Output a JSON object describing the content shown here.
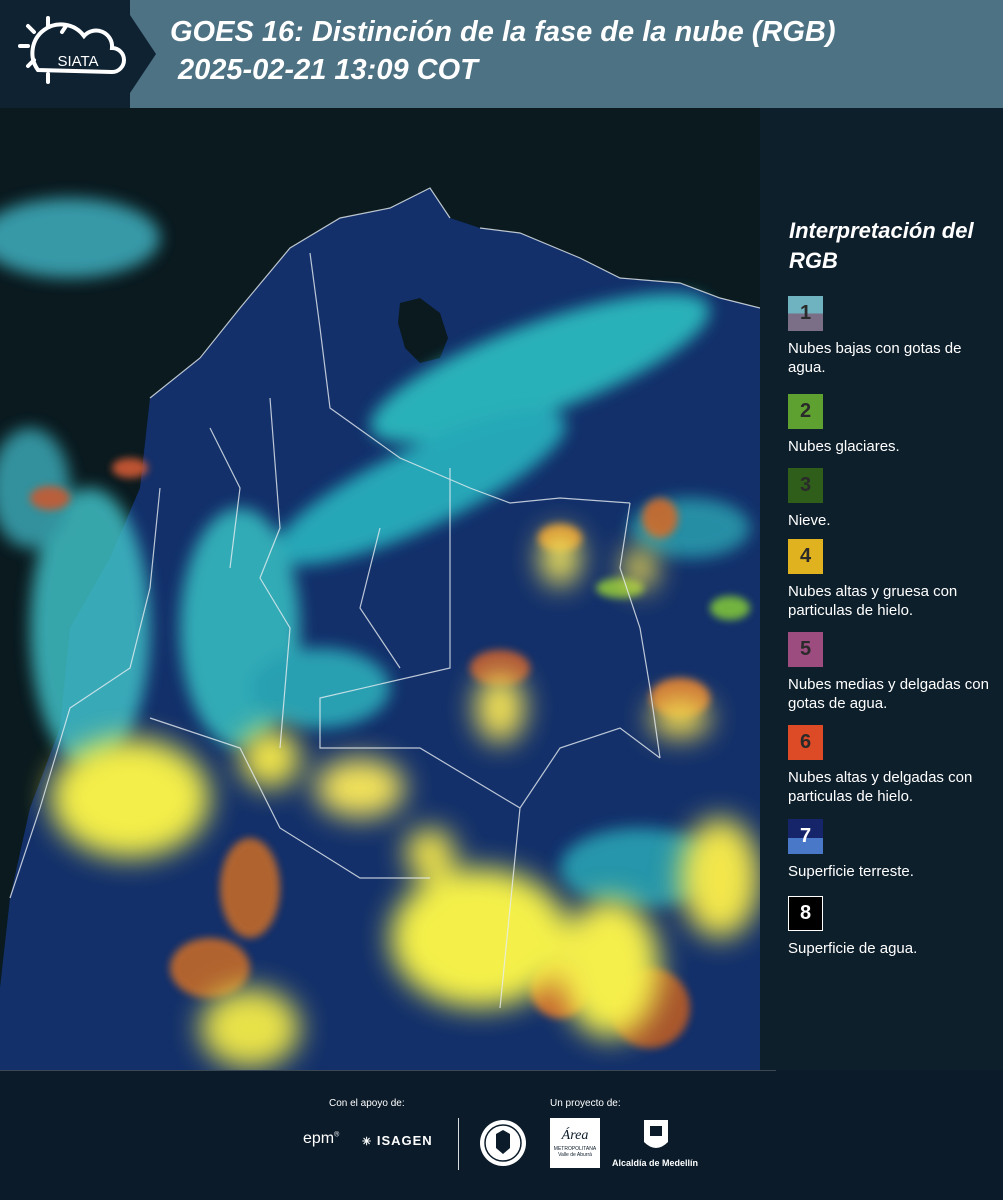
{
  "header": {
    "logo_text": "SIATA",
    "title": "GOES 16: Distinción de la fase de la nube (RGB)",
    "subtitle": "2025-02-21 13:09 COT"
  },
  "legend": {
    "title": "Interpretación del RGB",
    "items": [
      {
        "number": "1",
        "label": "Nubes bajas con gotas de agua.",
        "color_top": "#6fb3c0",
        "color_bottom": "#7a6f87"
      },
      {
        "number": "2",
        "label": "Nubes glaciares.",
        "color_top": "#5fa131",
        "color_bottom": "#5fa131"
      },
      {
        "number": "3",
        "label": "Nieve.",
        "color_top": "#2f5e1b",
        "color_bottom": "#2f5e1b"
      },
      {
        "number": "4",
        "label": "Nubes altas y gruesa con particulas de hielo.",
        "color_top": "#e0b21f",
        "color_bottom": "#e0b21f"
      },
      {
        "number": "5",
        "label": "Nubes medias y delgadas con gotas de agua.",
        "color_top": "#9c4c7f",
        "color_bottom": "#9c4c7f"
      },
      {
        "number": "6",
        "label": "Nubes altas y delgadas con particulas de hielo.",
        "color_top": "#dc4a26",
        "color_bottom": "#dc4a26"
      },
      {
        "number": "7",
        "label": "Superficie terreste.",
        "color_top": "#16246a",
        "color_bottom": "#4a78c8"
      },
      {
        "number": "8",
        "label": "Superficie de agua.",
        "color_top": "#000000",
        "color_bottom": "#000000"
      }
    ]
  },
  "footer": {
    "support_label": "Con el apoyo de:",
    "project_label": "Un proyecto de:",
    "sponsors": [
      "epm",
      "ISAGEN"
    ],
    "partners": [
      "Universidad de Medellín",
      "Área Metropolitana Valle de Aburrá",
      "Alcaldía de Medellín"
    ],
    "area_line1": "Área",
    "area_line2": "METROPOLITANA",
    "area_line3": "Valle de Aburrá",
    "alcaldia": "Alcaldía de Medellín"
  }
}
